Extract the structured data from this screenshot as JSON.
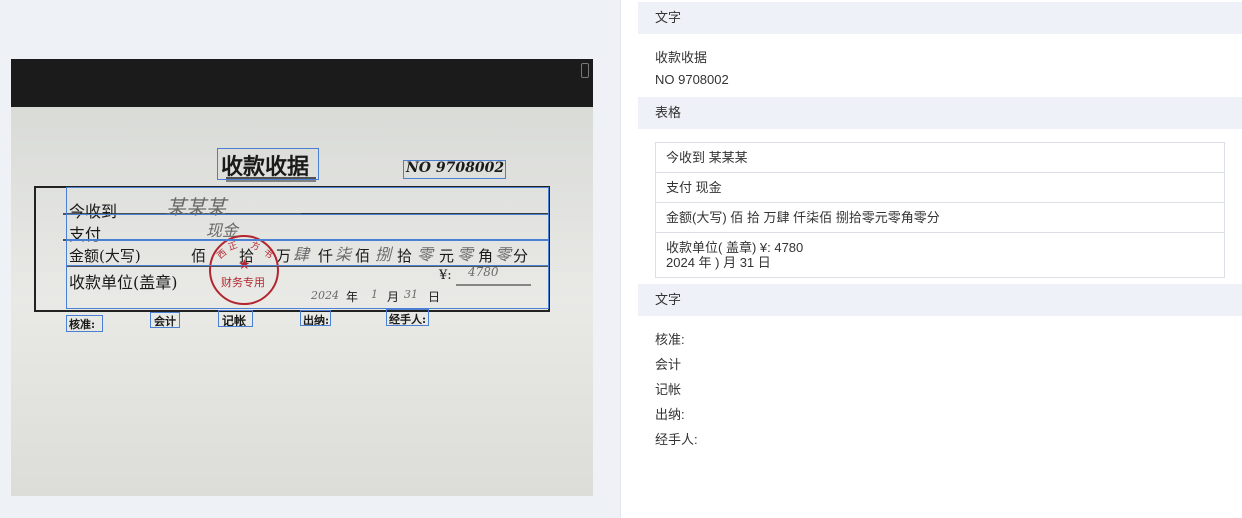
{
  "sections": [
    {
      "header": "文字",
      "lines": [
        "收款收据",
        "NO 9708002"
      ]
    },
    {
      "header": "表格",
      "rows": [
        [
          "今收到 某某某"
        ],
        [
          "支付 现金"
        ],
        [
          "金额(大写) 佰 拾 万肆 仟柒佰 捌拾零元零角零分"
        ],
        [
          "收款单位( 盖章) ¥: 4780",
          "2024 年 ) 月 31 日"
        ]
      ]
    },
    {
      "header": "文字",
      "lines": [
        "核准:",
        "会计",
        "记帐",
        "出纳:",
        "经手人:"
      ]
    }
  ],
  "receipt": {
    "title": "收款收据",
    "number": "NO 9708002",
    "received_label": "今收到",
    "received_value": "某某某",
    "pay_label": "支付",
    "pay_value": "现金",
    "amount_label": "金额(大写)",
    "amount_units": [
      "佰",
      "拾",
      "万",
      "仟",
      "佰",
      "拾",
      "元",
      "角",
      "分"
    ],
    "amount_digits": [
      "肆",
      "柒",
      "捌",
      "零",
      "零",
      "零"
    ],
    "unit_label": "收款单位(盖章)",
    "yen_label": "¥:",
    "yen_value": "4780",
    "date_year": "2024",
    "date_year_label": "年",
    "date_month": "1",
    "date_month_label": "月",
    "date_day": "31",
    "date_day_label": "日",
    "stamp_bottom": "财务专用",
    "footer": [
      "核准:",
      "会计",
      "记帐",
      "出纳:",
      "经手人:"
    ]
  }
}
